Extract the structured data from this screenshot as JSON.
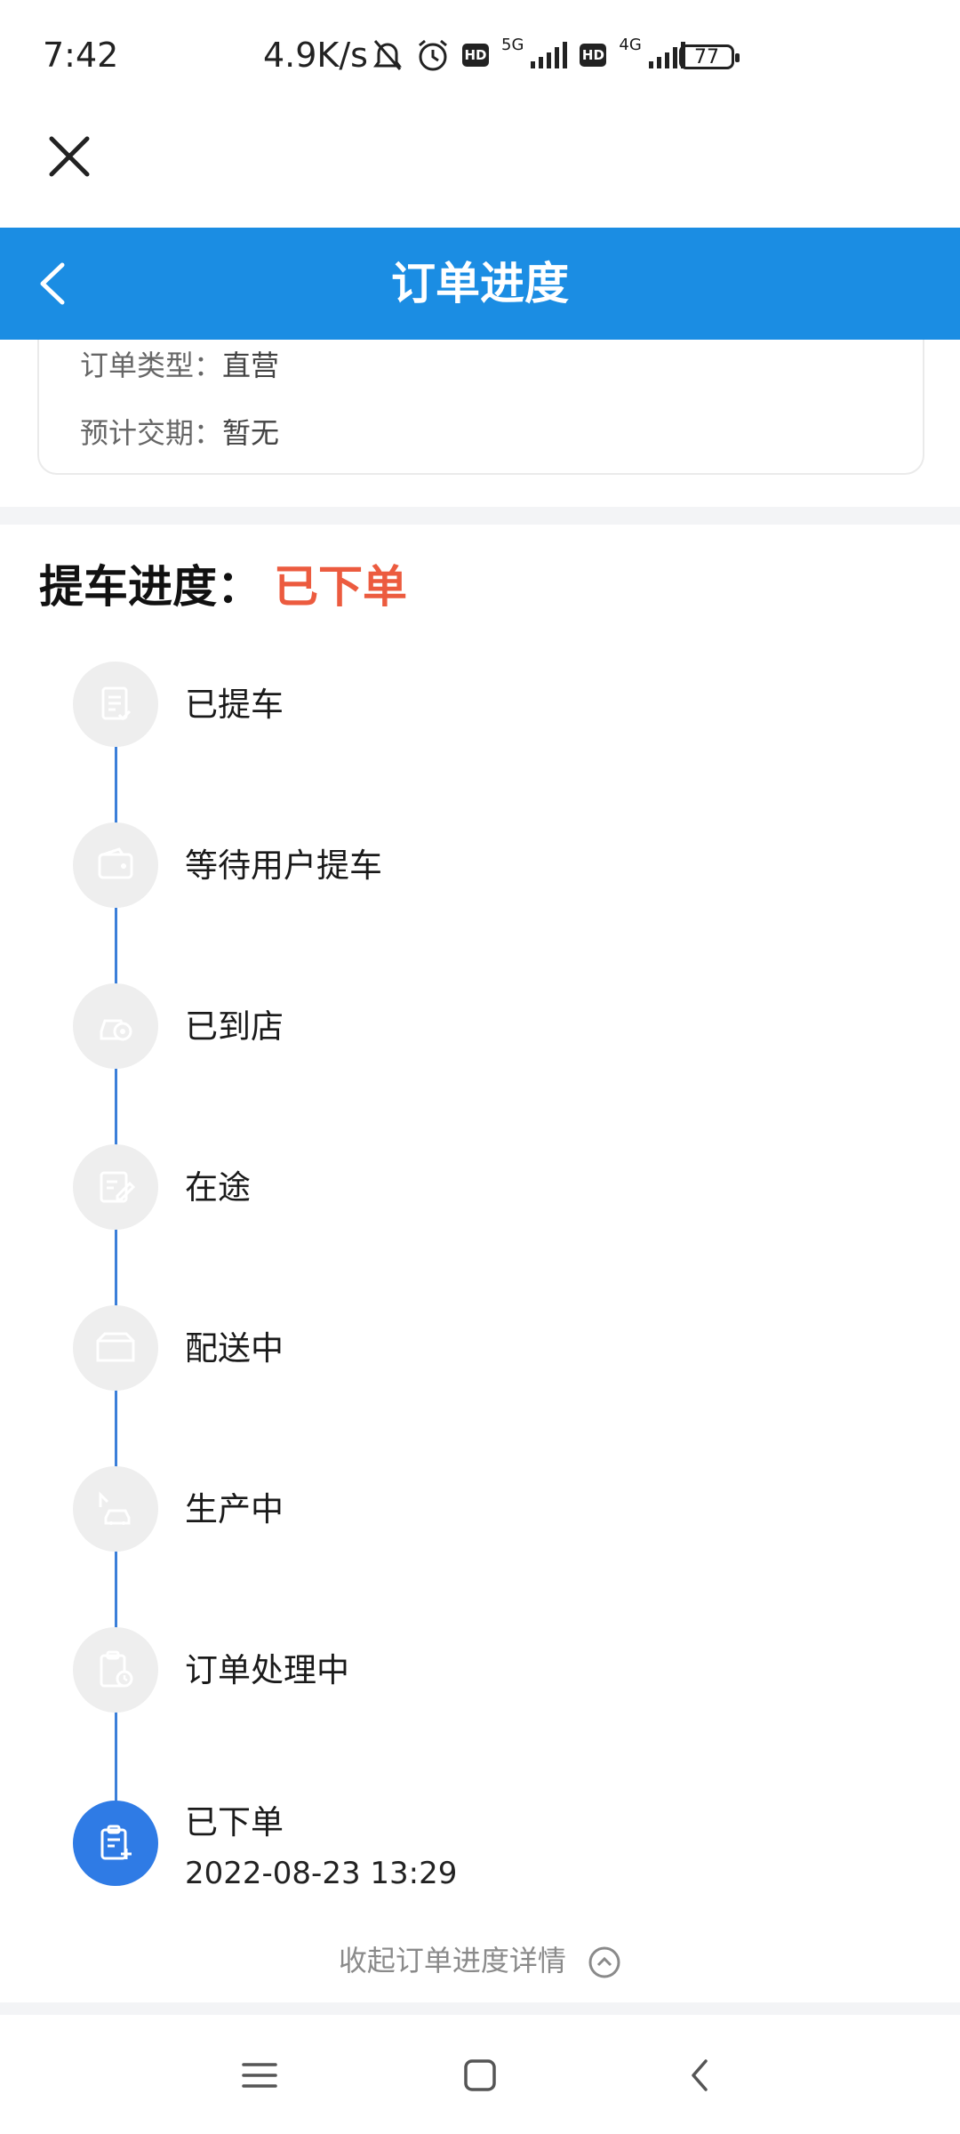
{
  "status_bar": {
    "time": "7:42",
    "net_speed": "4.9K/s",
    "hd1": "HD",
    "net1": "5G",
    "hd2": "HD",
    "net2": "4G",
    "battery": "77",
    "icons": [
      "mute-bell-icon",
      "alarm-icon",
      "signal-icon",
      "battery-icon"
    ]
  },
  "header": {
    "title": "订单进度"
  },
  "order_info": {
    "type_label": "订单类型：",
    "type_value": "直营",
    "delivery_label": "预计交期：",
    "delivery_value": "暂无"
  },
  "progress": {
    "title": "提车进度：",
    "status": "已下单",
    "steps": [
      {
        "label": "已提车",
        "icon": "checklist-icon",
        "active": false
      },
      {
        "label": "等待用户提车",
        "icon": "wallet-icon",
        "active": false
      },
      {
        "label": "已到店",
        "icon": "car-store-icon",
        "active": false
      },
      {
        "label": "在途",
        "icon": "edit-doc-icon",
        "active": false
      },
      {
        "label": "配送中",
        "icon": "erp-box-icon",
        "active": false
      },
      {
        "label": "生产中",
        "icon": "factory-car-icon",
        "active": false
      },
      {
        "label": "订单处理中",
        "icon": "clipboard-clock-icon",
        "active": false
      },
      {
        "label": "已下单",
        "time": "2022-08-23 13:29",
        "icon": "clipboard-plus-icon",
        "active": true
      }
    ],
    "collapse_label": "收起订单进度详情"
  },
  "colors": {
    "header_bg": "#1b8de3",
    "status_red": "#ec5b3f",
    "active_step": "#2f7be5",
    "timeline_line": "#3b7fd9"
  }
}
